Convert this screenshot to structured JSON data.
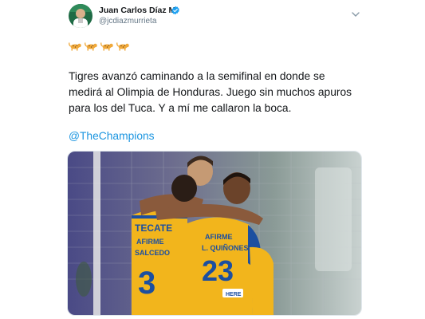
{
  "tweet": {
    "author": {
      "name": "Juan Carlos Díaz M.",
      "handle": "@jcdiazmurrieta",
      "verified": true
    },
    "emojis": [
      "leopard-icon",
      "leopard-icon",
      "leopard-icon",
      "leopard-icon"
    ],
    "text": "Tigres avanzó caminando a la semifinal en donde se medirá al Olimpia de Honduras. Juego sin muchos apuros para los del Tuca. Y a mí me callaron la boca.",
    "mention": "@TheChampions",
    "photo": {
      "jersey_sponsor": "AFIRME",
      "kit_brand": "TECATE",
      "player_left_name": "SALCEDO",
      "player_left_number": "3",
      "player_right_name": "L. QUIÑONES",
      "player_right_number": "23",
      "patch_text": "HERE"
    }
  },
  "colors": {
    "accent": "#1b95e0",
    "verified": "#1da1f2",
    "jersey": "#f2b51c",
    "jersey_trim": "#1c4fa0"
  }
}
